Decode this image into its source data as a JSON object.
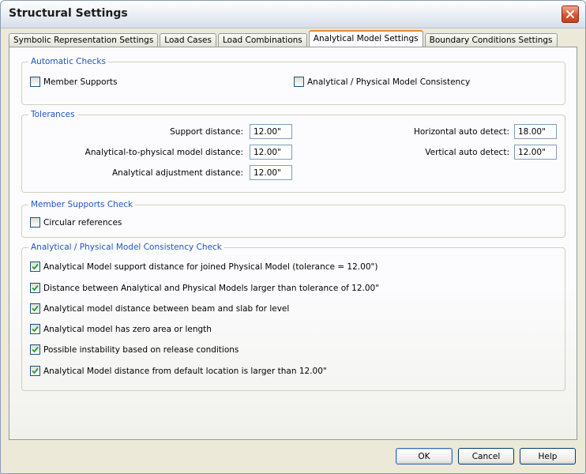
{
  "window": {
    "title": "Structural Settings"
  },
  "tabs": [
    {
      "label": "Symbolic Representation Settings",
      "active": false
    },
    {
      "label": "Load Cases",
      "active": false
    },
    {
      "label": "Load Combinations",
      "active": false
    },
    {
      "label": "Analytical Model Settings",
      "active": true
    },
    {
      "label": "Boundary Conditions Settings",
      "active": false
    }
  ],
  "automatic_checks": {
    "title": "Automatic Checks",
    "member_supports": {
      "label": "Member Supports",
      "checked": false
    },
    "consistency": {
      "label": "Analytical / Physical Model Consistency",
      "checked": false
    }
  },
  "tolerances": {
    "title": "Tolerances",
    "support_distance": {
      "label": "Support distance:",
      "value": "12.00\""
    },
    "analytical_to_physical": {
      "label": "Analytical-to-physical model distance:",
      "value": "12.00\""
    },
    "analytical_adjustment": {
      "label": "Analytical adjustment distance:",
      "value": "12.00\""
    },
    "horizontal_auto_detect": {
      "label": "Horizontal auto detect:",
      "value": "18.00\""
    },
    "vertical_auto_detect": {
      "label": "Vertical auto detect:",
      "value": "12.00\""
    }
  },
  "member_supports_check": {
    "title": "Member Supports Check",
    "circular_references": {
      "label": "Circular references",
      "checked": false
    }
  },
  "consistency_check": {
    "title": "Analytical / Physical Model Consistency Check",
    "items": [
      {
        "label": "Analytical Model support distance for joined Physical Model (tolerance = 12.00\")",
        "checked": true
      },
      {
        "label": "Distance between Analytical and Physical Models larger than tolerance of 12.00\"",
        "checked": true
      },
      {
        "label": "Analytical model distance between beam and slab for level",
        "checked": true
      },
      {
        "label": "Analytical model has zero area or length",
        "checked": true
      },
      {
        "label": "Possible instability based on release conditions",
        "checked": true
      },
      {
        "label": "Analytical Model distance from default location is larger than 12.00\"",
        "checked": true
      }
    ]
  },
  "buttons": {
    "ok": "OK",
    "cancel": "Cancel",
    "help": "Help"
  },
  "icons": {
    "close": "close-icon",
    "check": "checkmark-icon"
  },
  "colors": {
    "group_title": "#2255bb",
    "active_tab_accent": "#e68b2c",
    "close_button": "#d9542f"
  }
}
